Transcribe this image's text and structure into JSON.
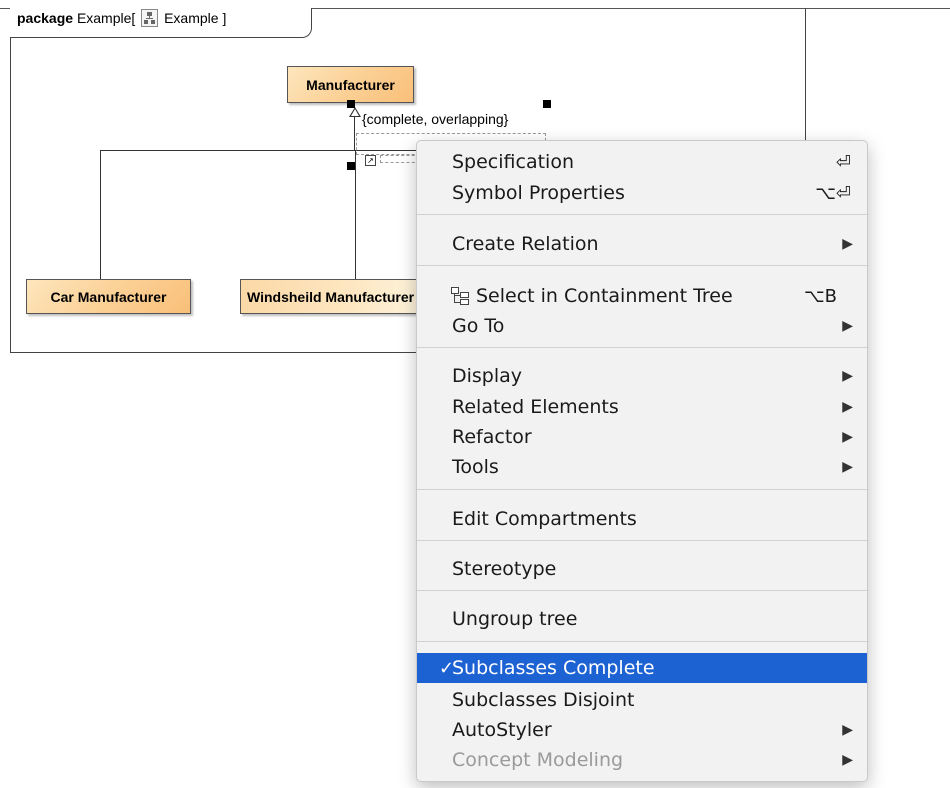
{
  "package_header": {
    "keyword": "package",
    "name": "Example",
    "bracket_open": "[",
    "diagram_name": "Example",
    "bracket_close": "]",
    "icon": "class-diagram-icon"
  },
  "diagram": {
    "superclass": "Manufacturer",
    "constraint": "{complete, overlapping}",
    "subclasses": [
      "Car Manufacturer",
      "Windsheild Manufacturer"
    ]
  },
  "context_menu": {
    "items": [
      {
        "label": "Specification",
        "shortcut": "⏎",
        "submenu": false
      },
      {
        "label": "Symbol Properties",
        "shortcut": "⌥⏎",
        "submenu": false
      },
      {
        "label": "Create Relation",
        "shortcut": "",
        "submenu": true
      },
      {
        "label": "Select in Containment Tree",
        "shortcut": "⌥B",
        "submenu": false,
        "icon": "containment-tree-icon"
      },
      {
        "label": "Go To",
        "shortcut": "",
        "submenu": true
      },
      {
        "label": "Display",
        "shortcut": "",
        "submenu": true
      },
      {
        "label": "Related Elements",
        "shortcut": "",
        "submenu": true
      },
      {
        "label": "Refactor",
        "shortcut": "",
        "submenu": true
      },
      {
        "label": "Tools",
        "shortcut": "",
        "submenu": true
      },
      {
        "label": "Edit Compartments",
        "shortcut": "",
        "submenu": false
      },
      {
        "label": "Stereotype",
        "shortcut": "",
        "submenu": false
      },
      {
        "label": "Ungroup tree",
        "shortcut": "",
        "submenu": false
      },
      {
        "label": "Subclasses Complete",
        "shortcut": "",
        "submenu": false,
        "checked": true,
        "highlighted": true
      },
      {
        "label": "Subclasses Disjoint",
        "shortcut": "",
        "submenu": false
      },
      {
        "label": "AutoStyler",
        "shortcut": "",
        "submenu": true
      },
      {
        "label": "Concept Modeling",
        "shortcut": "",
        "submenu": true,
        "disabled": true
      }
    ],
    "submenu_arrow": "▶",
    "check_mark": "✓"
  },
  "colors": {
    "class_fill": "#fbcf93",
    "menu_highlight": "#1d62d3",
    "menu_background": "#f2f2f2"
  }
}
